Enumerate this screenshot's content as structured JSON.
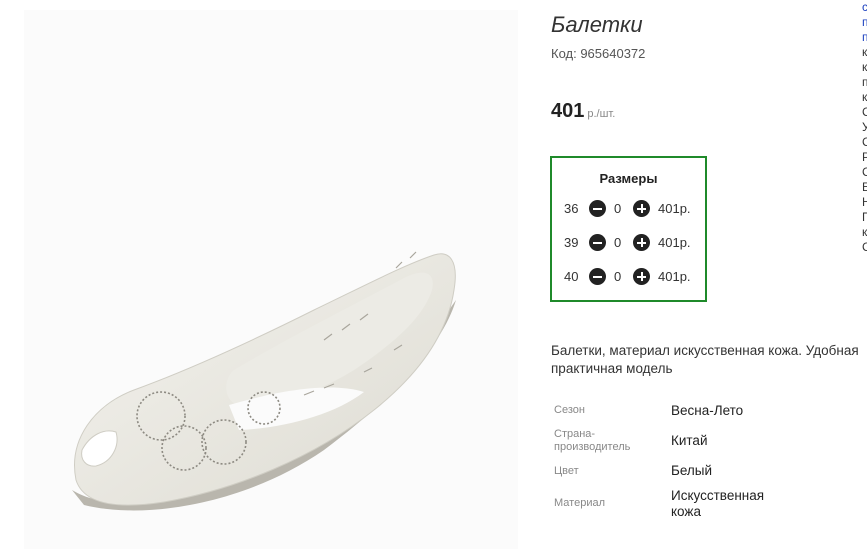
{
  "product": {
    "title": "Балетки",
    "code": "Код: 965640372",
    "price": "401",
    "price_unit": "р./шт."
  },
  "sizes": {
    "title": "Размеры",
    "rows": [
      {
        "size": "36",
        "qty": "0",
        "price": "401р."
      },
      {
        "size": "39",
        "qty": "0",
        "price": "401р."
      },
      {
        "size": "40",
        "qty": "0",
        "price": "401р."
      }
    ]
  },
  "description": "Балетки, материал искусственная кожа. Удобная практичная модель",
  "properties": [
    {
      "label": "Сезон",
      "value": "Весна-Лето"
    },
    {
      "label": "Страна-производитель",
      "value": "Китай"
    },
    {
      "label": "Цвет",
      "value": "Белый"
    },
    {
      "label": "Материал",
      "value": "Искусственная кожа"
    }
  ],
  "right_column": {
    "lines": [
      "с",
      "п",
      "п",
      "к",
      "к",
      "п",
      "к",
      "С",
      "У",
      "С",
      "Р",
      "С",
      "Е",
      "Н",
      "П",
      "к",
      "С"
    ]
  },
  "colors": {
    "sizes_border": "#1f8a2a",
    "link": "#1a3fbf"
  },
  "icons": {
    "minus": "minus-circle-icon",
    "plus": "plus-circle-icon"
  }
}
